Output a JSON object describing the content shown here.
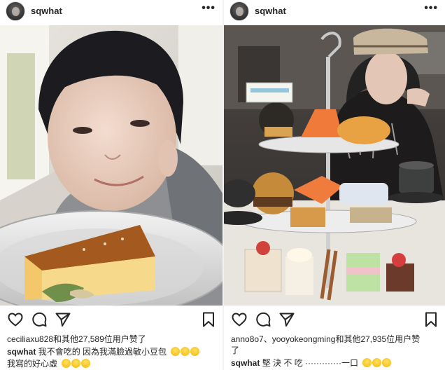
{
  "posts": [
    {
      "username": "sqwhat",
      "more_glyph": "•••",
      "liked_by": "ceciliaxu828和其他27,589位用户赞了",
      "caption_user": "sqwhat",
      "caption_text": "我不會吃的 因為我滿臉過敏小豆包",
      "caption_line2": "我寫的好心虛"
    },
    {
      "username": "sqwhat",
      "more_glyph": "•••",
      "liked_by": "anno8o7、yooyokeongming和其他27,935位用户赞",
      "liked_by_line2": "了",
      "caption_user": "sqwhat",
      "caption_text": "堅 決 不 吃 ·············一口"
    }
  ],
  "icons": {
    "like": "heart-icon",
    "comment": "comment-icon",
    "share": "paper-plane-icon",
    "save": "bookmark-icon",
    "emoji": "grinning-sweat-emoji"
  },
  "colors": {
    "text": "#262626",
    "background": "#ffffff"
  }
}
